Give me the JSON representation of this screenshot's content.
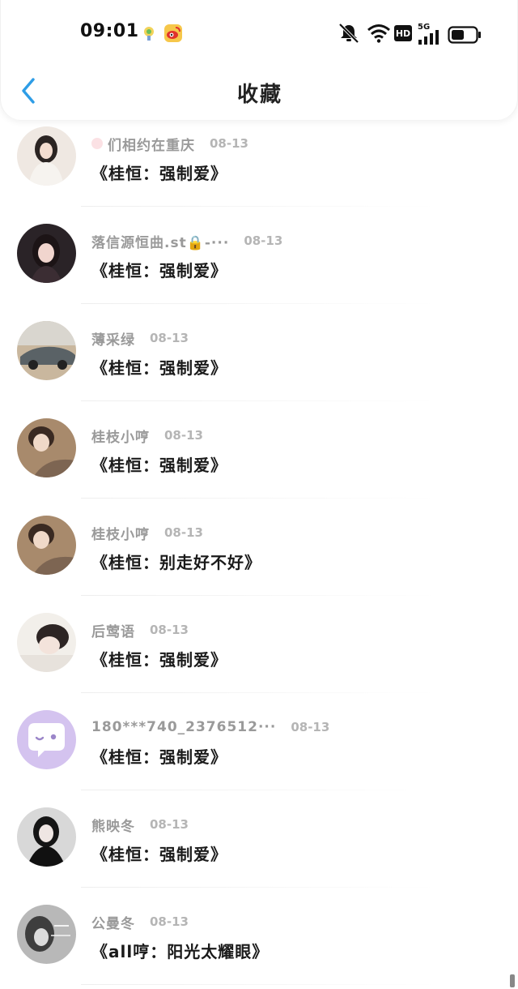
{
  "status_bar": {
    "time": "09:01",
    "icons": [
      "app-notification-icon",
      "weibo-icon",
      "mute-icon",
      "wifi-icon",
      "hd-icon",
      "5g-signal-icon",
      "battery-icon"
    ],
    "hd_label": "HD",
    "network_label": "5G"
  },
  "header": {
    "title": "收藏",
    "back_icon": "chevron-left-icon",
    "accent_color": "#2e9de6"
  },
  "items": [
    {
      "user": "们相约在重庆",
      "date": "08-13",
      "work": "《桂恒：强制爱》"
    },
    {
      "user": "落信源恒曲.st🔒-···",
      "date": "08-13",
      "work": "《桂恒：强制爱》"
    },
    {
      "user": "薄采绿",
      "date": "08-13",
      "work": "《桂恒：强制爱》"
    },
    {
      "user": "桂枝小哼",
      "date": "08-13",
      "work": "《桂恒：强制爱》"
    },
    {
      "user": "桂枝小哼",
      "date": "08-13",
      "work": "《桂恒：别走好不好》"
    },
    {
      "user": "后莺语",
      "date": "08-13",
      "work": "《桂恒：强制爱》"
    },
    {
      "user": "180***740_2376512···",
      "date": "08-13",
      "work": "《桂恒：强制爱》"
    },
    {
      "user": "熊映冬",
      "date": "08-13",
      "work": "《桂恒：强制爱》"
    },
    {
      "user": "公曼冬",
      "date": "08-13",
      "work": "《all哼：阳光太耀眼》"
    }
  ]
}
